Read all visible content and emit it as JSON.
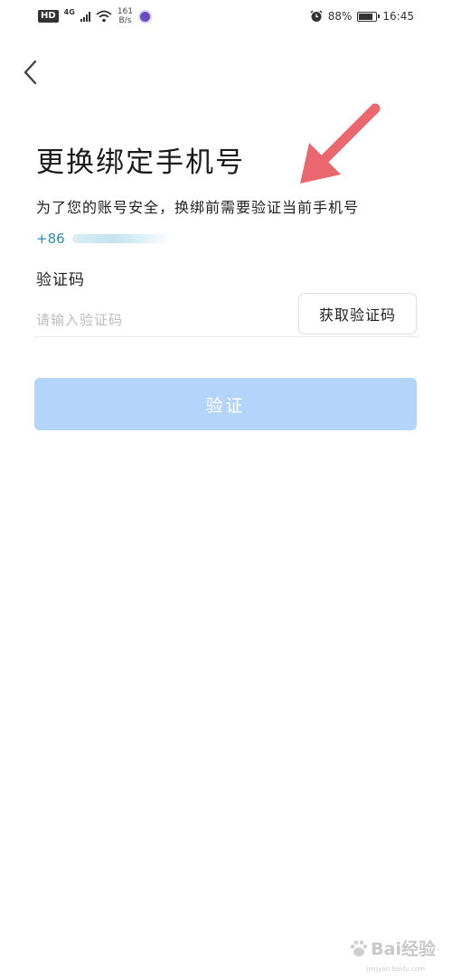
{
  "status_bar": {
    "hd": "HD",
    "network": "4G",
    "speed_value": "161",
    "speed_unit": "B/s",
    "battery_percent": "88%",
    "battery_level": 0.88,
    "time": "16:45"
  },
  "header": {
    "back_icon": "chevron-left-icon"
  },
  "main": {
    "title": "更换绑定手机号",
    "subtitle": "为了您的账号安全，换绑前需要验证当前手机号",
    "phone_prefix": "+86",
    "code_label": "验证码",
    "code_input": {
      "value": "",
      "placeholder": "请输入验证码"
    },
    "get_code_label": "获取验证码",
    "verify_label": "验证"
  },
  "annotation": {
    "arrow_color": "#ea6770"
  },
  "colors": {
    "verify_button": "#b4d4fb",
    "phone_prefix": "#2a8fa6"
  },
  "watermark": {
    "text": "Bai经验",
    "sub": "jingyan.baidu.com"
  }
}
